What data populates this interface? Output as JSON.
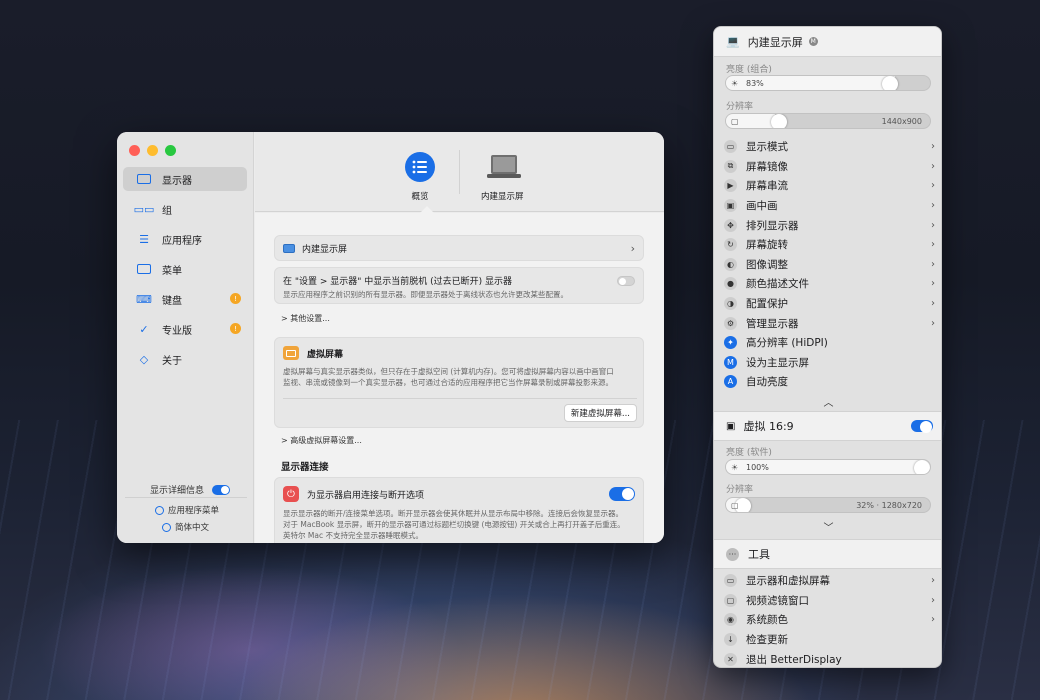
{
  "main_window": {
    "sidebar": {
      "items": [
        {
          "label": "显示器",
          "icon": "display-icon",
          "active": true
        },
        {
          "label": "组",
          "icon": "group-icon"
        },
        {
          "label": "应用程序",
          "icon": "apps-icon"
        },
        {
          "label": "菜单",
          "icon": "menu-icon"
        },
        {
          "label": "键盘",
          "icon": "keyboard-icon",
          "badge": "!"
        },
        {
          "label": "专业版",
          "icon": "pro-icon",
          "badge": "!"
        },
        {
          "label": "关于",
          "icon": "tag-icon"
        }
      ],
      "footer": {
        "detail_info_label": "显示详细信息",
        "app_menu_label": "应用程序菜单",
        "language_label": "简体中文"
      }
    },
    "toolbar": {
      "tabs": [
        {
          "label": "概览",
          "icon": "list-icon",
          "active": true
        },
        {
          "label": "内建显示屏",
          "icon": "laptop-icon"
        }
      ]
    },
    "content": {
      "builtin_display_label": "内建显示屏",
      "show_disconnected": {
        "title": "在 \"设置 > 显示器\" 中显示当前脱机 (过去已断开) 显示器",
        "desc": "显示应用程序之前识别的所有显示器。即便显示器处于离线状态也允许更改某些配置。"
      },
      "other_settings_label": "> 其他设置...",
      "virtual_screen": {
        "title": "虚拟屏幕",
        "desc_line1": "虚拟屏幕与真实显示器类似，但只存在于虚拟空间 (计算机内存)。您可将虚拟屏幕内容以画中画窗口",
        "desc_line2": "监视、串流或镜像到一个真实显示器，也可通过合适的应用程序把它当作屏幕录制或屏幕投影来源。",
        "button_label": "新建虚拟屏幕..."
      },
      "advanced_virtual_label": "> 高级虚拟屏幕设置...",
      "connection_section_title": "显示器连接",
      "connection": {
        "title": "为显示器启用连接与断开选项",
        "desc_line1": "显示显示器的断开/连接菜单选项。断开显示器会使其休眠并从显示布局中移除。连接后会恢复显示器。",
        "desc_line2": "对于 MacBook 显示屏，断开的显示器可通过标题栏切换键 (电源按钮) 开关或合上再打开盖子后重连。",
        "desc_line3": "英特尔 Mac 不支持完全显示器睡眠模式。"
      }
    }
  },
  "menu_panel": {
    "builtin": {
      "title": "内建显示屏",
      "brightness_label": "亮度 (组合)",
      "brightness_value": "83%",
      "brightness_fraction": 0.83,
      "resolution_label": "分辨率",
      "resolution_value": "1440x900",
      "resolution_fraction": 0.24
    },
    "items": [
      {
        "label": "显示模式",
        "icon": "display-mode-icon",
        "chevron": true
      },
      {
        "label": "屏幕镜像",
        "icon": "mirror-icon",
        "chevron": true
      },
      {
        "label": "屏幕串流",
        "icon": "stream-icon",
        "chevron": true
      },
      {
        "label": "画中画",
        "icon": "pip-icon",
        "chevron": true
      },
      {
        "label": "排列显示器",
        "icon": "arrange-icon",
        "chevron": true
      },
      {
        "label": "屏幕旋转",
        "icon": "rotate-icon",
        "chevron": true
      },
      {
        "label": "图像调整",
        "icon": "image-adjust-icon",
        "chevron": true
      },
      {
        "label": "颜色描述文件",
        "icon": "color-profile-icon",
        "chevron": true
      },
      {
        "label": "配置保护",
        "icon": "shield-icon",
        "chevron": true
      },
      {
        "label": "管理显示器",
        "icon": "manage-icon",
        "chevron": true
      },
      {
        "label": "高分辨率 (HiDPI)",
        "icon": "hidpi-icon",
        "blue": true
      },
      {
        "label": "设为主显示屏",
        "icon": "main-display-icon",
        "blue": true
      },
      {
        "label": "自动亮度",
        "icon": "auto-brightness-icon",
        "blue": true
      }
    ],
    "virtual": {
      "title": "虚拟 16:9",
      "brightness_label": "亮度 (软件)",
      "brightness_value": "100%",
      "brightness_fraction": 1.0,
      "resolution_label": "分辨率",
      "resolution_value": "32% · 1280x720",
      "resolution_fraction": 0.05
    },
    "tools_title": "工具",
    "tool_items": [
      {
        "label": "显示器和虚拟屏幕",
        "icon": "displays-icon",
        "chevron": true
      },
      {
        "label": "视频滤镜窗口",
        "icon": "filter-icon",
        "chevron": true
      },
      {
        "label": "系统颜色",
        "icon": "system-color-icon",
        "chevron": true
      },
      {
        "label": "检查更新",
        "icon": "update-icon"
      },
      {
        "label": "退出 BetterDisplay",
        "icon": "quit-icon"
      }
    ]
  }
}
